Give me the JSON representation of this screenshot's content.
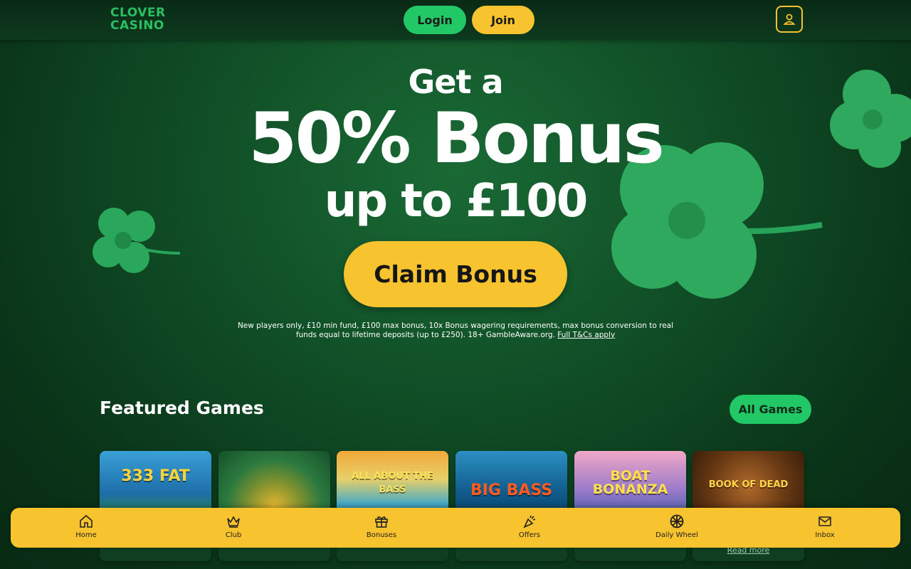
{
  "brand": {
    "logo_line1": "CLOVER",
    "logo_line2": "CASINO",
    "logo_color": "#2bbf63"
  },
  "header": {
    "login_label": "Login",
    "join_label": "Join",
    "account_icon": "user-icon"
  },
  "hero": {
    "line1": "Get a",
    "line2": "50% Bonus",
    "line3": "up to £100",
    "cta_label": "Claim Bonus",
    "terms_text": "New players only, £10 min fund, £100 max bonus, 10x Bonus wagering requirements, max bonus conversion to real funds equal to lifetime deposits (up to £250). 18+ GambleAware.org.",
    "terms_link": "Full T&Cs apply"
  },
  "featured": {
    "title": "Featured Games",
    "all_games_label": "All Games",
    "games": [
      {
        "name": "333 FAT",
        "readmore": ""
      },
      {
        "name": "",
        "readmore": ""
      },
      {
        "name": "ALL ABOUT THE BASS",
        "readmore": ""
      },
      {
        "name": "BIG BASS",
        "readmore": ""
      },
      {
        "name": "BOAT BONANZA",
        "readmore": ""
      },
      {
        "name": "BOOK OF DEAD",
        "readmore": "Read more"
      }
    ]
  },
  "bottom_nav": {
    "items": [
      {
        "label": "Home",
        "icon": "home-icon"
      },
      {
        "label": "Club",
        "icon": "crown-icon"
      },
      {
        "label": "Bonuses",
        "icon": "gift-icon"
      },
      {
        "label": "Offers",
        "icon": "party-popper-icon"
      },
      {
        "label": "Daily Wheel",
        "icon": "wheel-icon"
      },
      {
        "label": "Inbox",
        "icon": "envelope-icon"
      }
    ]
  },
  "colors": {
    "accent_yellow": "#f7c32e",
    "accent_green": "#22c766",
    "background": "#0f4b25"
  }
}
